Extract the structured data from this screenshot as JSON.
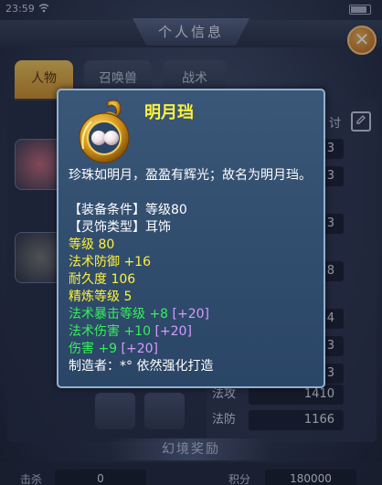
{
  "status_bar": {
    "time": "23:59"
  },
  "header": {
    "title": "个人信息"
  },
  "tabs": [
    {
      "label": "人物"
    },
    {
      "label": "召唤兽"
    },
    {
      "label": "战术"
    }
  ],
  "close_label": "✕",
  "edit_label": "讨",
  "stats": [
    {
      "name": "",
      "value": "3"
    },
    {
      "name": "",
      "value": "3"
    },
    {
      "name": "",
      "value": "3"
    },
    {
      "name": "",
      "value": "8"
    },
    {
      "name": "",
      "value": "4"
    },
    {
      "name": "",
      "value": "3"
    },
    {
      "name": "",
      "value": "3"
    },
    {
      "name": "法攻",
      "value": "1410"
    },
    {
      "name": "法防",
      "value": "1166"
    }
  ],
  "section_banner": "幻境奖励",
  "bottom": {
    "label_1": "击杀",
    "value_1": "0",
    "label_2": "积分",
    "value_2": "180000"
  },
  "tooltip": {
    "name": "明月珰",
    "description": "珍珠如明月，盈盈有辉光；故名为明月珰。",
    "lines": [
      {
        "parts": [
          {
            "text": "【装备条件】等级80",
            "color": "white"
          }
        ]
      },
      {
        "parts": [
          {
            "text": "【灵饰类型】耳饰",
            "color": "white"
          }
        ]
      },
      {
        "parts": [
          {
            "text": "等级 80",
            "color": "yellow"
          }
        ]
      },
      {
        "parts": [
          {
            "text": "法术防御 +16",
            "color": "yellow"
          }
        ]
      },
      {
        "parts": [
          {
            "text": "耐久度 106",
            "color": "yellow"
          }
        ]
      },
      {
        "parts": [
          {
            "text": "精炼等级 5",
            "color": "yellow"
          }
        ]
      },
      {
        "parts": [
          {
            "text": "法术暴击等级 +8 ",
            "color": "green"
          },
          {
            "text": "[+20]",
            "color": "purple"
          }
        ]
      },
      {
        "parts": [
          {
            "text": "法术伤害 +10 ",
            "color": "green"
          },
          {
            "text": "[+20]",
            "color": "purple"
          }
        ]
      },
      {
        "parts": [
          {
            "text": "伤害 +9 ",
            "color": "green"
          },
          {
            "text": "[+20]",
            "color": "purple"
          }
        ]
      },
      {
        "parts": [
          {
            "text": "制造者：*° 依然强化打造",
            "color": "white"
          }
        ]
      }
    ]
  },
  "colors": {
    "title_yellow": "#fff23a",
    "base_stat_yellow": "#fff23a",
    "bonus_green": "#35f05a",
    "refine_purple": "#d49cff",
    "tooltip_bg": "#2f4c6d",
    "tooltip_border": "#8fb1d4"
  },
  "icons": {
    "item": "gold-pearl-earring-icon",
    "close": "close-icon",
    "edit": "edit-icon"
  }
}
